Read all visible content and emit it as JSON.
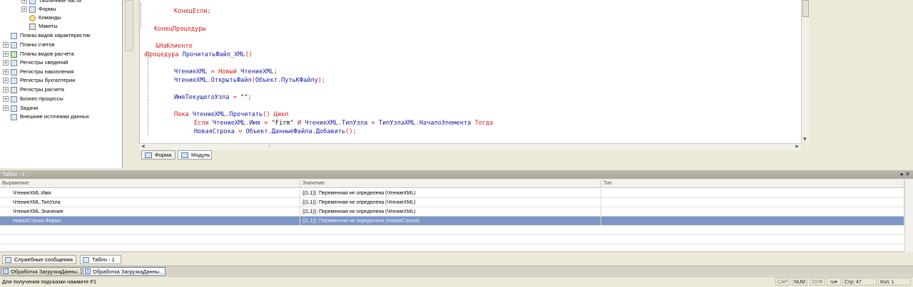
{
  "tree": {
    "items": [
      {
        "label": "Табличные части",
        "expander": "+",
        "icon": "table-icon"
      },
      {
        "label": "Формы",
        "expander": "+",
        "icon": "form-icon"
      },
      {
        "label": "Команды",
        "expander": "",
        "icon": "command-icon"
      },
      {
        "label": "Макеты",
        "expander": "",
        "icon": "template-icon"
      },
      {
        "label": "Планы видов характеристик",
        "expander": "",
        "icon": "chart-types-icon"
      },
      {
        "label": "Планы счетов",
        "expander": "+",
        "icon": "accounts-chart-icon"
      },
      {
        "label": "Планы видов расчета",
        "expander": "+",
        "icon": "calc-types-icon"
      },
      {
        "label": "Регистры сведений",
        "expander": "+",
        "icon": "info-register-icon"
      },
      {
        "label": "Регистры накопления",
        "expander": "+",
        "icon": "accum-register-icon"
      },
      {
        "label": "Регистры бухгалтерии",
        "expander": "+",
        "icon": "accounting-register-icon"
      },
      {
        "label": "Регистры расчета",
        "expander": "+",
        "icon": "calc-register-icon"
      },
      {
        "label": "Бизнес-процессы",
        "expander": "+",
        "icon": "business-process-icon"
      },
      {
        "label": "Задачи",
        "expander": "+",
        "icon": "tasks-icon"
      },
      {
        "label": "Внешние источники данных",
        "expander": "",
        "icon": "external-data-icon"
      }
    ]
  },
  "editor": {
    "tabs": [
      {
        "label": "Форма",
        "icon": "form-icon"
      },
      {
        "label": "Модуль",
        "icon": "module-icon"
      }
    ]
  },
  "panel": {
    "title": "Табло - 1",
    "columns": [
      "Выражение",
      "Значение",
      "Тип"
    ],
    "rows": [
      {
        "expr": "ЧтениеXML.Имя",
        "value": "{(1,1)}: Переменная не определена (ЧтениеXML)",
        "type": ""
      },
      {
        "expr": "ЧтениеXML.ТипУзла",
        "value": "{(1,1)}: Переменная не определена (ЧтениеXML)",
        "type": ""
      },
      {
        "expr": "ЧтениеXML.Значение",
        "value": "{(1,1)}: Переменная не определена (ЧтениеXML)",
        "type": ""
      },
      {
        "expr": "НоваяСтрока.Фирма",
        "value": "{(1,1)}: Переменная не определена (НоваяСтрока)",
        "type": ""
      }
    ]
  },
  "bottom_tabs": [
    {
      "label": "Служебные сообщения",
      "icon": "messages-icon"
    },
    {
      "label": "Табло - 1",
      "icon": "watch-icon"
    }
  ],
  "window_tabs": [
    {
      "label": "Обработка ЗагрузкаДанны..."
    },
    {
      "label": "Обработка ЗагрузкаДанны..."
    }
  ],
  "status": {
    "hint": "Для получения подсказки нажмите F1",
    "cap": "CAP",
    "num": "NUM",
    "ovr": "OVR",
    "lang": "ru",
    "line": "Стр: 47",
    "col": "Кол: 1"
  }
}
